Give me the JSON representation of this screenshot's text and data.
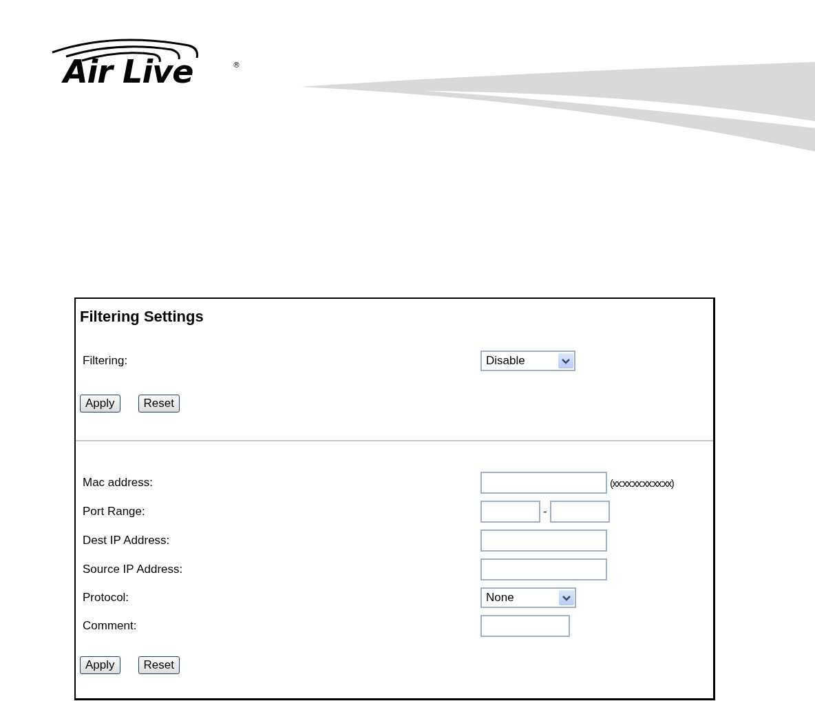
{
  "logo": {
    "text": "Air Live",
    "mark": "®"
  },
  "panel": {
    "title": "Filtering Settings",
    "filtering": {
      "label": "Filtering:",
      "value": "Disable"
    },
    "top_buttons": [
      "Apply",
      "Reset"
    ],
    "fields": [
      {
        "kind": "text",
        "label": "Mac address:",
        "hint": "(xx:xx:xx:xx:xx:xx)"
      },
      {
        "kind": "range",
        "label": "Port Range:",
        "separator": "-"
      },
      {
        "kind": "text",
        "label": "Dest IP Address:"
      },
      {
        "kind": "text",
        "label": "Source IP Address:"
      },
      {
        "kind": "select",
        "label": "Protocol:",
        "value": "None"
      },
      {
        "kind": "short",
        "label": "Comment:"
      }
    ],
    "bottom_buttons": [
      "Apply",
      "Reset"
    ]
  }
}
